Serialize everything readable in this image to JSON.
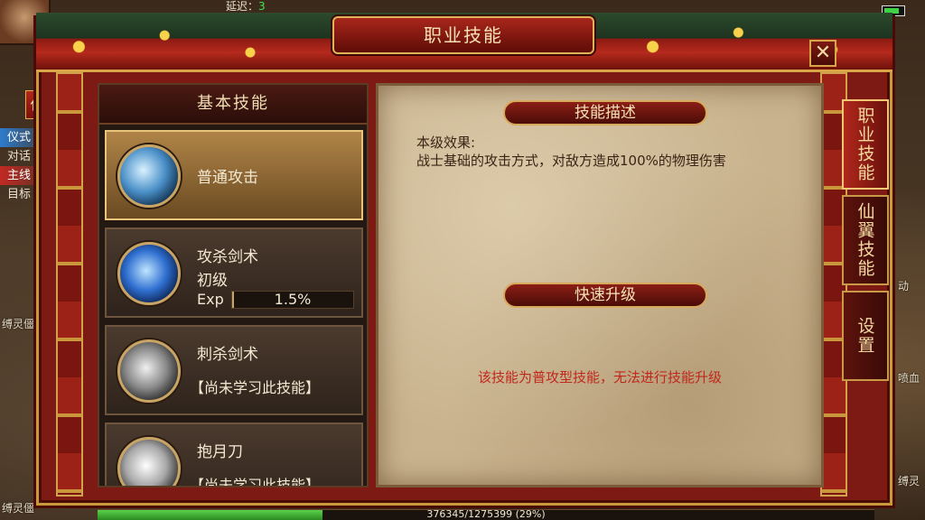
{
  "hud": {
    "latency_label": "延迟：",
    "latency_value": "3",
    "side_button": "任",
    "quest_tags": [
      "仪式",
      "对话",
      "主线",
      "目标"
    ]
  },
  "world_labels": [
    "缚灵僵尸",
    "动",
    "喷血",
    "缚灵僵",
    "缚灵"
  ],
  "window": {
    "title": "职业技能",
    "close_icon": "✕"
  },
  "skills": {
    "header": "基本技能",
    "items": [
      {
        "name": "普通攻击",
        "level": "",
        "note": "",
        "icon": "sword-slash-icon"
      },
      {
        "name": "攻杀剑术",
        "level": "初级",
        "exp_label": "Exp",
        "exp_value": "1.5%",
        "exp_fraction": 0.015,
        "icon": "blue-sword-icon"
      },
      {
        "name": "刺杀剑术",
        "note": "【尚未学习此技能】",
        "icon": "thrust-sword-icon"
      },
      {
        "name": "抱月刀",
        "note": "【尚未学习此技能】",
        "icon": "crescent-blade-icon"
      }
    ]
  },
  "description": {
    "section_title": "技能描述",
    "effect_label": "本级效果:",
    "effect_text": "战士基础的攻击方式，对敌方造成100%的物理伤害",
    "upgrade_title": "快速升级",
    "upgrade_message": "该技能为普攻型技能，无法进行技能升级"
  },
  "tabs": [
    {
      "label": "职业技能",
      "active": true
    },
    {
      "label": "仙翼技能",
      "active": false
    },
    {
      "label": "设置",
      "active": false
    }
  ],
  "experience": {
    "text": "376345/1275399 (29%)",
    "fraction": 0.29
  },
  "colors": {
    "frame_red": "#7d1a14",
    "gold_trim": "#c99a3b",
    "parchment": "#c9b38e",
    "warning_red": "#c0281c"
  }
}
